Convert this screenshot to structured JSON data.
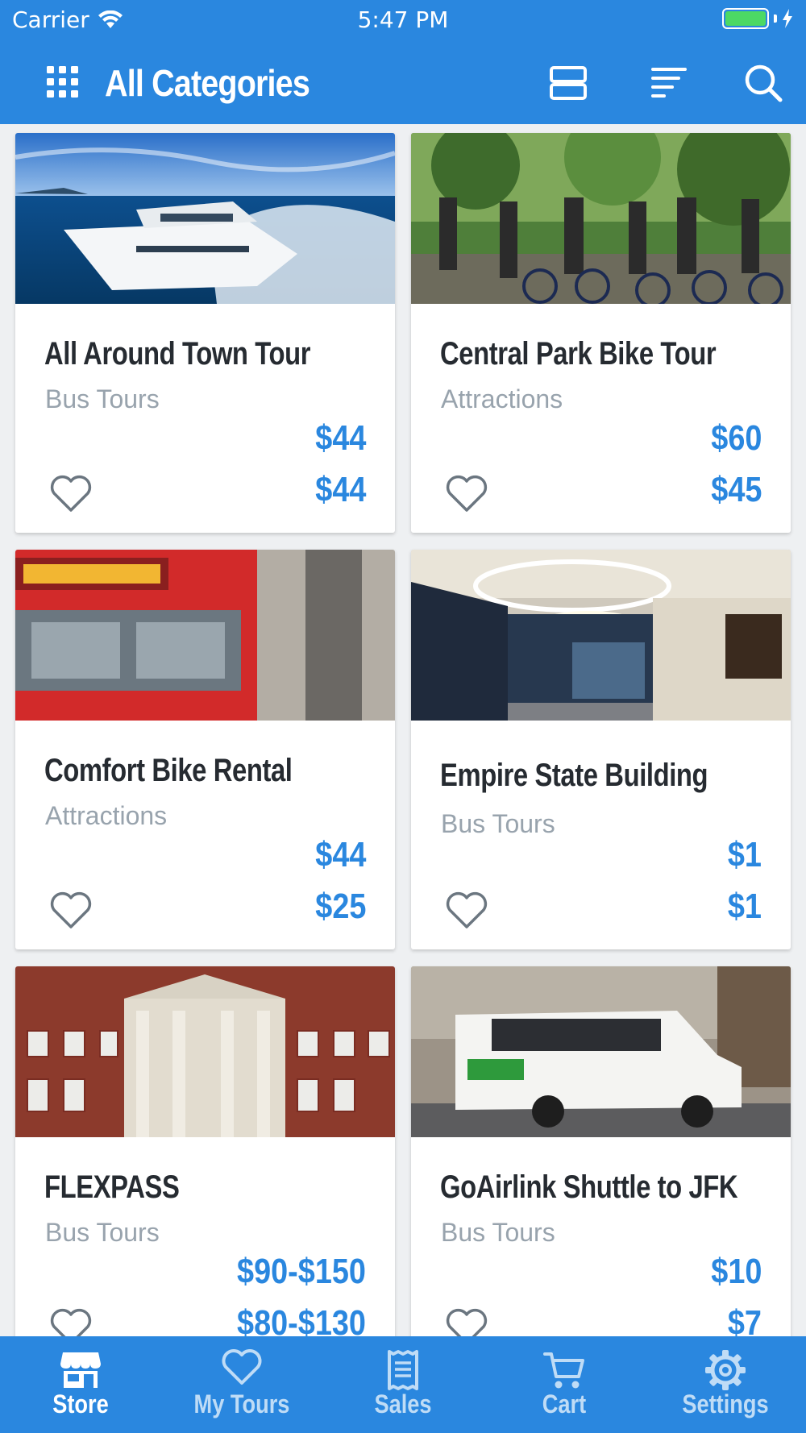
{
  "status_bar": {
    "carrier": "Carrier",
    "time": "5:47 PM"
  },
  "app_bar": {
    "title": "All Categories"
  },
  "cards": [
    {
      "name": "All Around Town Tour",
      "category": "Bus Tours",
      "price_top": "$44",
      "price_bottom": "$44",
      "image": "yacht-photo"
    },
    {
      "name": "Central Park Bike Tour",
      "category": "Attractions",
      "price_top": "$60",
      "price_bottom": "$45",
      "image": "cyclists-photo"
    },
    {
      "name": "Comfort Bike Rental",
      "category": "Attractions",
      "price_top": "$44",
      "price_bottom": "$25",
      "image": "red-bus-photo"
    },
    {
      "name": "Empire State Building",
      "category": "Bus Tours",
      "price_top": "$1",
      "price_bottom": "$1",
      "image": "lobby-photo"
    },
    {
      "name": "FLEXPASS",
      "category": "Bus Tours",
      "price_top": "$90-$150",
      "price_bottom": "$80-$130",
      "image": "brick-building-photo"
    },
    {
      "name": "GoAirlink Shuttle to JFK",
      "category": "Bus Tours",
      "price_top": "$10",
      "price_bottom": "$7",
      "image": "shuttle-van-photo"
    }
  ],
  "tabs": [
    {
      "label": "Store",
      "icon": "store-icon",
      "active": true
    },
    {
      "label": "My Tours",
      "icon": "heart-icon",
      "active": false
    },
    {
      "label": "Sales",
      "icon": "receipt-icon",
      "active": false
    },
    {
      "label": "Cart",
      "icon": "cart-icon",
      "active": false
    },
    {
      "label": "Settings",
      "icon": "gear-icon",
      "active": false
    }
  ],
  "colors": {
    "primary": "#2a87df",
    "price": "#2a87df",
    "title_text": "#262b31",
    "category_text": "#98a3ad"
  }
}
